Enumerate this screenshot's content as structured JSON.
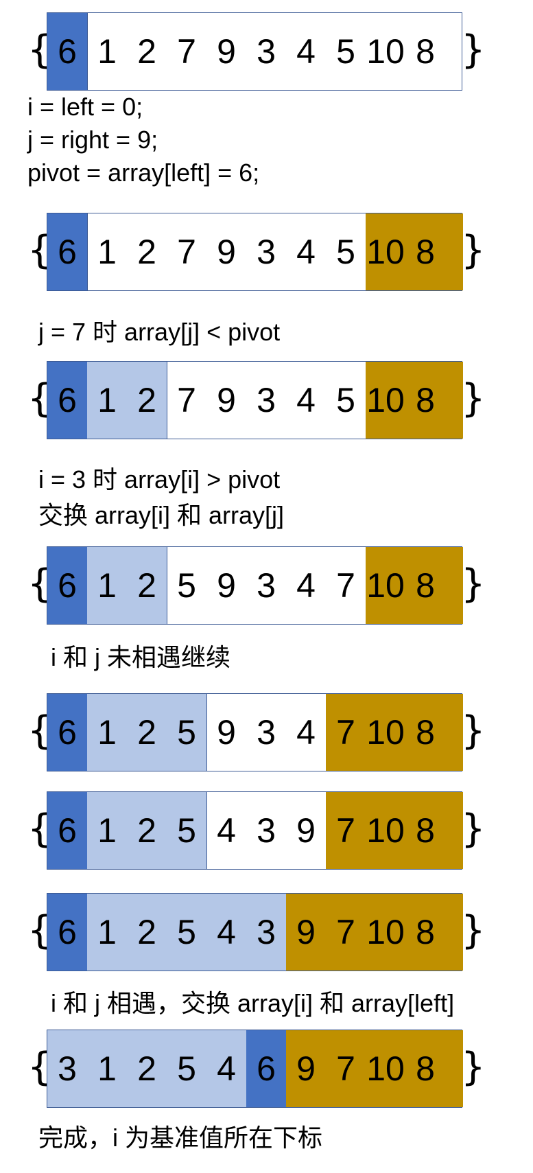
{
  "colors": {
    "pivot": "#4472c4",
    "lessthan": "#b4c7e7",
    "greater": "#bf9000",
    "border": "#3c5a94"
  },
  "braces": {
    "open": "{",
    "close": "}"
  },
  "rows": [
    {
      "nums": [
        "6",
        "1",
        "2",
        "7",
        "9",
        "3",
        "4",
        "5",
        "10",
        "8"
      ],
      "segs": [
        "pivot",
        0,
        1
      ]
    },
    {
      "nums": [
        "6",
        "1",
        "2",
        "7",
        "9",
        "3",
        "4",
        "5",
        "10",
        "8"
      ],
      "segs": [
        "pivot",
        0,
        1,
        "greater",
        8,
        10
      ]
    },
    {
      "nums": [
        "6",
        "1",
        "2",
        "7",
        "9",
        "3",
        "4",
        "5",
        "10",
        "8"
      ],
      "segs": [
        "pivot",
        0,
        1,
        "lessthan",
        1,
        3,
        "greater",
        8,
        10
      ]
    },
    {
      "nums": [
        "6",
        "1",
        "2",
        "5",
        "9",
        "3",
        "4",
        "7",
        "10",
        "8"
      ],
      "segs": [
        "pivot",
        0,
        1,
        "lessthan",
        1,
        3,
        "greater",
        8,
        10
      ]
    },
    {
      "nums": [
        "6",
        "1",
        "2",
        "5",
        "9",
        "3",
        "4",
        "7",
        "10",
        "8"
      ],
      "segs": [
        "pivot",
        0,
        1,
        "lessthan",
        1,
        4,
        "greater",
        7,
        10
      ]
    },
    {
      "nums": [
        "6",
        "1",
        "2",
        "5",
        "4",
        "3",
        "9",
        "7",
        "10",
        "8"
      ],
      "segs": [
        "pivot",
        0,
        1,
        "lessthan",
        1,
        4,
        "greater",
        7,
        10
      ]
    },
    {
      "nums": [
        "6",
        "1",
        "2",
        "5",
        "4",
        "3",
        "9",
        "7",
        "10",
        "8"
      ],
      "segs": [
        "pivot",
        0,
        1,
        "lessthan",
        1,
        6,
        "greater",
        6,
        10
      ]
    },
    {
      "nums": [
        "3",
        "1",
        "2",
        "5",
        "4",
        "6",
        "9",
        "7",
        "10",
        "8"
      ],
      "segs": [
        "lessthan",
        0,
        5,
        "pivot",
        5,
        6,
        "greater",
        6,
        10
      ]
    }
  ],
  "texts": {
    "init_i": "i = left = 0;",
    "init_j": "j = right = 9;",
    "init_pivot": "pivot = array[left] = 6;",
    "step_j": "j = 7 时 array[j] < pivot",
    "step_i": "i = 3 时 array[i] > pivot",
    "swap": "交换 array[i] 和 array[j]",
    "continue": "i 和 j 未相遇继续",
    "meet": "i 和 j 相遇，交换 array[i] 和 array[left]",
    "done": "完成，i 为基准值所在下标"
  }
}
